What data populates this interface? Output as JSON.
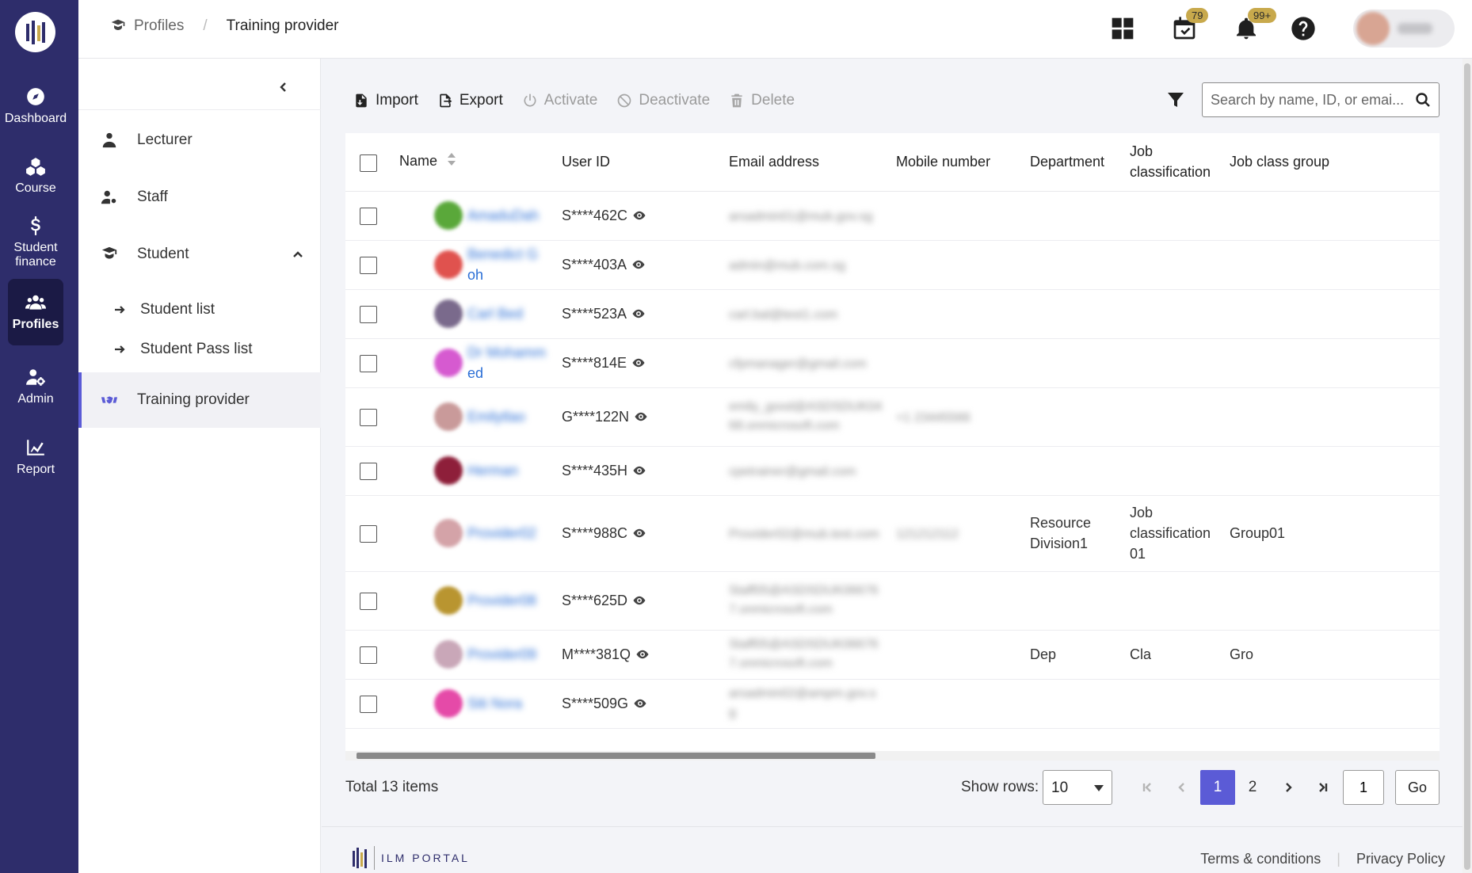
{
  "nav": {
    "items": [
      {
        "label": "Dashboard",
        "icon": "compass-icon"
      },
      {
        "label": "Course",
        "icon": "cubes-icon"
      },
      {
        "label": "Student finance",
        "icon": "dollar-icon"
      },
      {
        "label": "Profiles",
        "icon": "users-icon",
        "active": true
      },
      {
        "label": "Admin",
        "icon": "user-gear-icon"
      },
      {
        "label": "Report",
        "icon": "chart-icon"
      }
    ]
  },
  "header": {
    "breadcrumb": {
      "parent": "Profiles",
      "current": "Training provider"
    },
    "tasks_badge": "79",
    "notifications_badge": "99+"
  },
  "submenu": {
    "items": {
      "lecturer": "Lecturer",
      "staff": "Staff",
      "student": "Student",
      "student_list": "Student list",
      "student_pass_list": "Student Pass list",
      "training_provider": "Training provider"
    }
  },
  "toolbar": {
    "import": "Import",
    "export": "Export",
    "activate": "Activate",
    "deactivate": "Deactivate",
    "delete": "Delete",
    "search_placeholder": "Search by name, ID, or emai..."
  },
  "table": {
    "columns": {
      "name": "Name",
      "user_id": "User ID",
      "email": "Email address",
      "mobile": "Mobile number",
      "department": "Department",
      "job_classification": "Job classification",
      "job_class_group": "Job class group"
    },
    "rows": [
      {
        "name_blur": "AmaduDah",
        "name_suffix": "",
        "avatar": "#5aa83a",
        "user_id": "S****462C",
        "email": "arsadmin01@mub.gov.sg",
        "mobile": "",
        "department": "",
        "job_classification": "",
        "group": ""
      },
      {
        "name_blur": "Benedict G",
        "name_suffix": "oh",
        "avatar": "#e0524e",
        "user_id": "S****403A",
        "email": "admin@mub.com.sg",
        "mobile": "",
        "department": "",
        "job_classification": "",
        "group": ""
      },
      {
        "name_blur": "Carl Bed",
        "name_suffix": "",
        "avatar": "#7a6a8c",
        "user_id": "S****523A",
        "email": "carl.bal@test1.com",
        "mobile": "",
        "department": "",
        "job_classification": "",
        "group": ""
      },
      {
        "name_blur": "Dr Mohamm",
        "name_suffix": "ed",
        "avatar": "#d65ad0",
        "user_id": "S****814E",
        "email": "cfpmanager@gmail.com",
        "mobile": "",
        "department": "",
        "job_classification": "",
        "group": ""
      },
      {
        "name_blur": "Emilytlao",
        "name_suffix": "",
        "avatar": "#c99a9a",
        "user_id": "G****122N",
        "email": "emily_good@ASDSDUK04 68.onmicrosoft.com",
        "mobile": "+1 23445566",
        "department": "",
        "job_classification": "",
        "group": ""
      },
      {
        "name_blur": "Herman",
        "name_suffix": "",
        "avatar": "#8e1f3a",
        "user_id": "S****435H",
        "email": "cpetrainer@gmail.com",
        "mobile": "",
        "department": "",
        "job_classification": "",
        "group": ""
      },
      {
        "name_blur": "Provider02",
        "name_suffix": "",
        "avatar": "#d4a3a8",
        "user_id": "S****988C",
        "email": "Provider02@mub.test.com",
        "mobile": "121212112",
        "department": "Resource Division1",
        "job_classification": "Job classification 01",
        "group": "Group01"
      },
      {
        "name_blur": "Provider08",
        "name_suffix": "",
        "avatar": "#b99530",
        "user_id": "S****625D",
        "email": "Staff05@ASDSDUK06676 7.onmicrosoft.com",
        "mobile": "",
        "department": "",
        "job_classification": "",
        "group": ""
      },
      {
        "name_blur": "Provider09",
        "name_suffix": "",
        "avatar": "#c9a7b8",
        "user_id": "M****381Q",
        "email": "Staff05@ASDSDUK06676 7.onmicrosoft.com",
        "mobile": "",
        "department": "Dep",
        "job_classification": "Cla",
        "group": "Gro"
      },
      {
        "name_blur": "Siti Nora",
        "name_suffix": "",
        "avatar": "#e54aa8",
        "user_id": "S****509G",
        "email": "arsadmin02@ampm.gov.s g",
        "mobile": "",
        "department": "",
        "job_classification": "",
        "group": ""
      }
    ]
  },
  "pagination": {
    "total": "Total 13 items",
    "show_rows_label": "Show rows:",
    "rows_value": "10",
    "pages": [
      "1",
      "2"
    ],
    "current_page": "1",
    "goto_value": "1",
    "go_label": "Go"
  },
  "footer": {
    "brand": "ILM PORTAL",
    "terms": "Terms & conditions",
    "privacy": "Privacy Policy"
  }
}
